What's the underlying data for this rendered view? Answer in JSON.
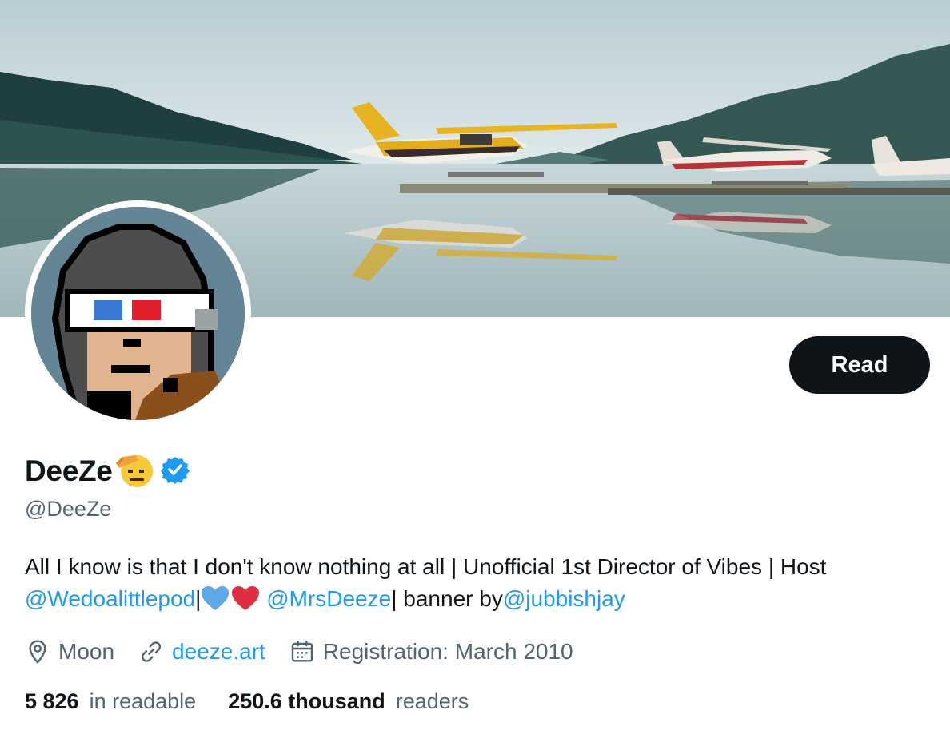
{
  "profile": {
    "display_name": "DeeZe",
    "handle": "@DeeZe",
    "verified": true
  },
  "actions": {
    "read_label": "Read"
  },
  "bio": {
    "text_1": "All I know is that I don't know nothing at all | Unofficial 1st Director of Vibes | Host",
    "mention_1": "@Wedoalittlepod",
    "sep_1": "|",
    "mention_2": "@MrsDeeze",
    "text_2": "| banner by",
    "mention_3": "@jubbishjay"
  },
  "meta": {
    "location": "Moon",
    "website": "deeze.art",
    "registration": "Registration: March 2010"
  },
  "stats": {
    "following_count": "5 826",
    "following_label": "in readable",
    "followers_count": "250.6 thousand",
    "followers_label": "readers"
  },
  "icons": {
    "location": "location-pin-icon",
    "website": "link-icon",
    "calendar": "calendar-icon",
    "verified": "verified-badge-icon",
    "emoji": "saluting-face-emoji"
  },
  "colors": {
    "accent": "#1d9bf0",
    "button_bg": "#0f1419",
    "secondary_text": "#536471"
  }
}
